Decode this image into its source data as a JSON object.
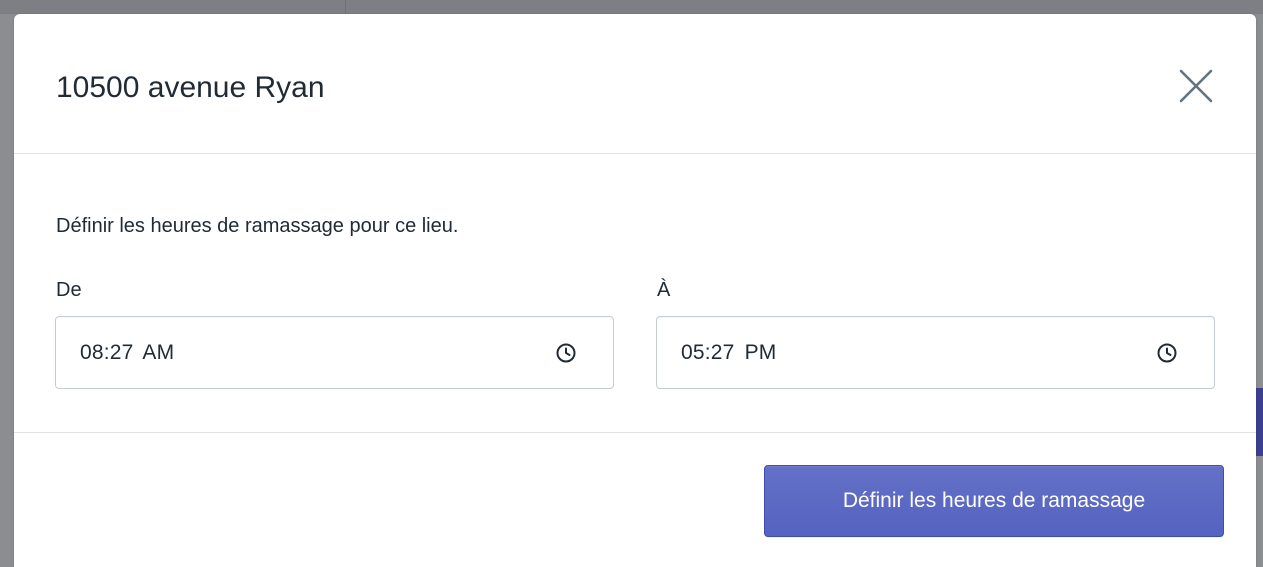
{
  "modal": {
    "title": "10500 avenue Ryan",
    "description": "Définir les heures de ramassage pour ce lieu.",
    "from": {
      "label": "De",
      "value": "08:27 AM"
    },
    "to": {
      "label": "À",
      "value": "05:27 PM"
    },
    "submit_label": "Définir les heures de ramassage"
  },
  "icons": {
    "close": "close-icon",
    "clock": "clock-icon"
  },
  "colors": {
    "primary": "#5c6ac4",
    "border": "#c4cdd5",
    "divider": "#dfe3e8",
    "text": "#212b36",
    "overlay": "#8b8d91"
  }
}
